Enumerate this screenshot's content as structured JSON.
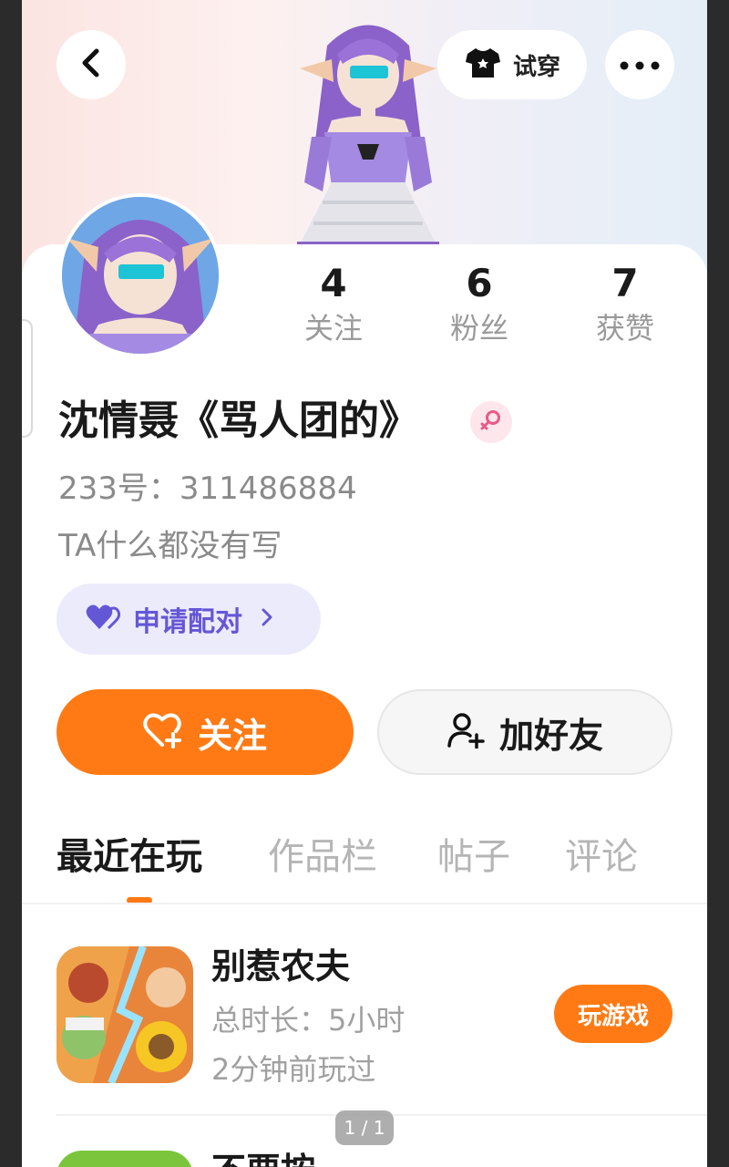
{
  "header": {
    "try_on_label": "试穿"
  },
  "profile": {
    "stats": [
      {
        "value": "4",
        "label": "关注"
      },
      {
        "value": "6",
        "label": "粉丝"
      },
      {
        "value": "7",
        "label": "获赞"
      }
    ],
    "username": "沈情聂《骂人团的》",
    "gender": "female",
    "id_line": "233号：311486884",
    "bio": "TA什么都没有写",
    "pair_label": "申请配对"
  },
  "actions": {
    "follow_label": "关注",
    "add_friend_label": "加好友"
  },
  "tabs": [
    {
      "label": "最近在玩",
      "active": true
    },
    {
      "label": "作品栏",
      "active": false
    },
    {
      "label": "帖子",
      "active": false
    },
    {
      "label": "评论",
      "active": false
    }
  ],
  "games": [
    {
      "title": "别惹农夫",
      "duration": "总时长：5小时",
      "last_played": "2分钟前玩过",
      "play_label": "玩游戏"
    },
    {
      "title": "不要按"
    }
  ],
  "page_indicator": "1 / 1",
  "colors": {
    "accent": "#ff7a14",
    "pair_text": "#6457d6",
    "pair_bg": "#ecebfb",
    "gender_female": "#e85a8a"
  }
}
